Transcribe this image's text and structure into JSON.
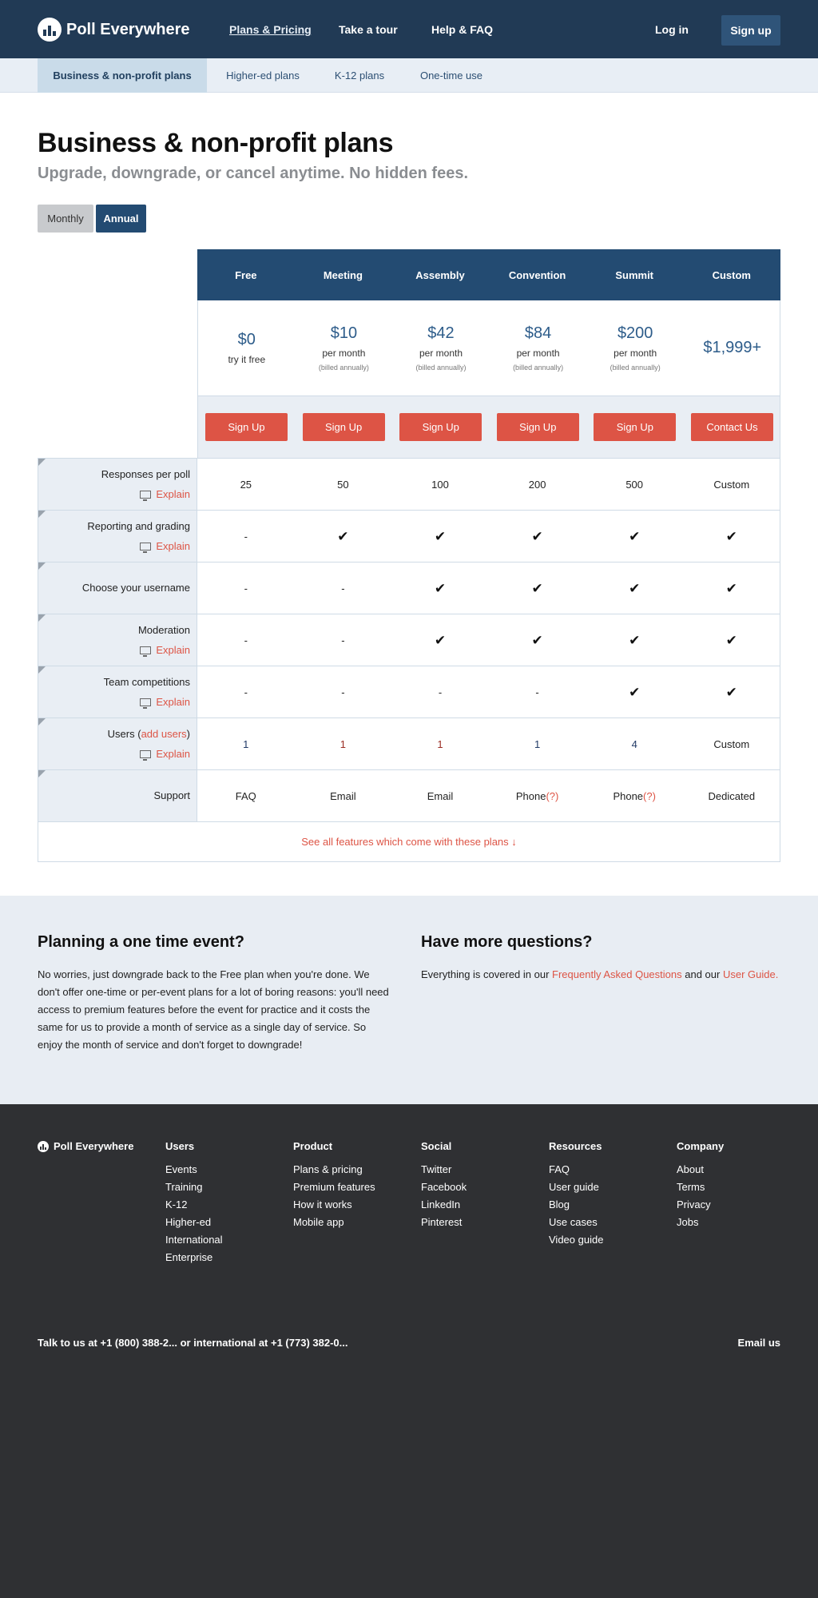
{
  "nav": {
    "brand": "Poll Everywhere",
    "links": [
      "Plans & Pricing",
      "Take a tour",
      "Help & FAQ"
    ],
    "login": "Log in",
    "signup": "Sign up"
  },
  "subnav": {
    "tabs": [
      "Business & non-profit plans",
      "Higher-ed plans",
      "K-12 plans",
      "One-time use"
    ]
  },
  "page": {
    "title": "Business & non-profit plans",
    "subtitle": "Upgrade, downgrade, or cancel anytime. No hidden fees.",
    "billing": {
      "monthly": "Monthly",
      "annual": "Annual",
      "selected": "Annual"
    }
  },
  "pricing": {
    "plans": [
      {
        "name": "Free",
        "price": "$0",
        "note": "try it free",
        "per": "",
        "billed": "",
        "button": "Sign Up"
      },
      {
        "name": "Meeting",
        "price": "$10",
        "note": "",
        "per": "per month",
        "billed": "(billed annually)",
        "button": "Sign Up"
      },
      {
        "name": "Assembly",
        "price": "$42",
        "note": "",
        "per": "per month",
        "billed": "(billed annually)",
        "button": "Sign Up"
      },
      {
        "name": "Convention",
        "price": "$84",
        "note": "",
        "per": "per month",
        "billed": "(billed annually)",
        "button": "Sign Up"
      },
      {
        "name": "Summit",
        "price": "$200",
        "note": "",
        "per": "per month",
        "billed": "(billed annually)",
        "button": "Sign Up"
      },
      {
        "name": "Custom",
        "price": "$1,999+",
        "note": "",
        "per": "",
        "billed": "",
        "button": "Contact Us"
      }
    ],
    "explain_label": "Explain",
    "features": [
      {
        "name": "Responses per poll",
        "explain": true,
        "values": [
          "25",
          "50",
          "100",
          "200",
          "500",
          "Custom"
        ]
      },
      {
        "name": "Reporting and grading",
        "explain": true,
        "values": [
          "-",
          "✔",
          "✔",
          "✔",
          "✔",
          "✔"
        ]
      },
      {
        "name": "Choose your username",
        "explain": false,
        "values": [
          "-",
          "-",
          "✔",
          "✔",
          "✔",
          "✔"
        ]
      },
      {
        "name": "Moderation",
        "explain": true,
        "values": [
          "-",
          "-",
          "✔",
          "✔",
          "✔",
          "✔"
        ]
      },
      {
        "name": "Team competitions",
        "explain": true,
        "values": [
          "-",
          "-",
          "-",
          "-",
          "✔",
          "✔"
        ]
      },
      {
        "name_prefix": "Users (",
        "name_link": "add users",
        "name_suffix": ")",
        "explain": true,
        "values": [
          "1",
          "1",
          "1",
          "1",
          "4",
          "Custom"
        ]
      },
      {
        "name": "Support",
        "explain": false,
        "values": [
          "FAQ",
          "Email",
          "Email",
          "Phone",
          "Phone",
          "Dedicated"
        ],
        "help_mark": "(?)"
      }
    ],
    "see_all": "See all features which come with these plans ↓"
  },
  "info": {
    "one_time": {
      "title": "Planning a one time event?",
      "body": "No worries, just downgrade back to the Free plan when you're done. We don't offer one-time or per-event plans for a lot of boring reasons: you'll need access to premium features before the event for practice and it costs the same for us to provide a month of service as a single day of service. So enjoy the month of service and don't forget to downgrade!"
    },
    "questions": {
      "title": "Have more questions?",
      "text_1": "Everything is covered in our ",
      "link_1": "Frequently Asked Questions",
      "text_2": " and our ",
      "link_2": "User Guide."
    }
  },
  "footer": {
    "brand": "Poll Everywhere",
    "columns": [
      {
        "title": "Users",
        "links": [
          "Events",
          "Training",
          "K-12",
          "Higher-ed",
          "International",
          "Enterprise"
        ]
      },
      {
        "title": "Product",
        "links": [
          "Plans & pricing",
          "Premium features",
          "How it works",
          "Mobile app"
        ]
      },
      {
        "title": "Social",
        "links": [
          "Twitter",
          "Facebook",
          "LinkedIn",
          "Pinterest"
        ]
      },
      {
        "title": "Resources",
        "links": [
          "FAQ",
          "User guide",
          "Blog",
          "Use cases",
          "Video guide"
        ]
      },
      {
        "title": "Company",
        "links": [
          "About",
          "Terms",
          "Privacy",
          "Jobs"
        ]
      }
    ],
    "talk": "Talk to us at +1 (800) 388-2... or international at +1 (773) 382-0...",
    "email": "Email us"
  },
  "colors": {
    "nav_bg": "#213a55",
    "accent_blue": "#234b72",
    "accent_red": "#dd5445",
    "footer_bg": "#2f3033",
    "light_panel": "#e8edf3"
  }
}
